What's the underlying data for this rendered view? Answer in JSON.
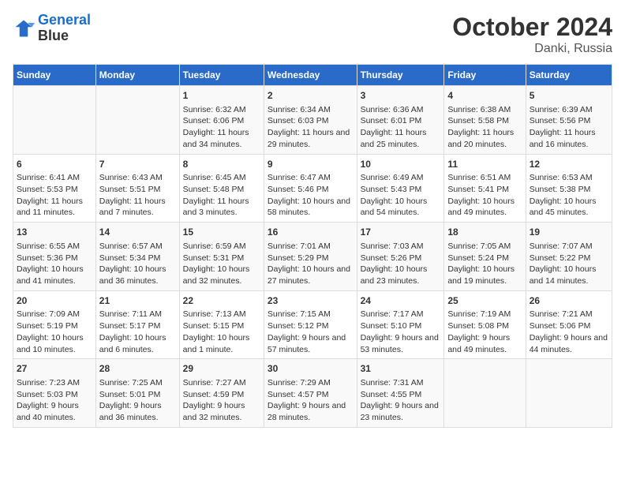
{
  "header": {
    "logo_line1": "General",
    "logo_line2": "Blue",
    "title": "October 2024",
    "subtitle": "Danki, Russia"
  },
  "days_of_week": [
    "Sunday",
    "Monday",
    "Tuesday",
    "Wednesday",
    "Thursday",
    "Friday",
    "Saturday"
  ],
  "weeks": [
    [
      {
        "day": "",
        "info": ""
      },
      {
        "day": "",
        "info": ""
      },
      {
        "day": "1",
        "info": "Sunrise: 6:32 AM\nSunset: 6:06 PM\nDaylight: 11 hours and 34 minutes."
      },
      {
        "day": "2",
        "info": "Sunrise: 6:34 AM\nSunset: 6:03 PM\nDaylight: 11 hours and 29 minutes."
      },
      {
        "day": "3",
        "info": "Sunrise: 6:36 AM\nSunset: 6:01 PM\nDaylight: 11 hours and 25 minutes."
      },
      {
        "day": "4",
        "info": "Sunrise: 6:38 AM\nSunset: 5:58 PM\nDaylight: 11 hours and 20 minutes."
      },
      {
        "day": "5",
        "info": "Sunrise: 6:39 AM\nSunset: 5:56 PM\nDaylight: 11 hours and 16 minutes."
      }
    ],
    [
      {
        "day": "6",
        "info": "Sunrise: 6:41 AM\nSunset: 5:53 PM\nDaylight: 11 hours and 11 minutes."
      },
      {
        "day": "7",
        "info": "Sunrise: 6:43 AM\nSunset: 5:51 PM\nDaylight: 11 hours and 7 minutes."
      },
      {
        "day": "8",
        "info": "Sunrise: 6:45 AM\nSunset: 5:48 PM\nDaylight: 11 hours and 3 minutes."
      },
      {
        "day": "9",
        "info": "Sunrise: 6:47 AM\nSunset: 5:46 PM\nDaylight: 10 hours and 58 minutes."
      },
      {
        "day": "10",
        "info": "Sunrise: 6:49 AM\nSunset: 5:43 PM\nDaylight: 10 hours and 54 minutes."
      },
      {
        "day": "11",
        "info": "Sunrise: 6:51 AM\nSunset: 5:41 PM\nDaylight: 10 hours and 49 minutes."
      },
      {
        "day": "12",
        "info": "Sunrise: 6:53 AM\nSunset: 5:38 PM\nDaylight: 10 hours and 45 minutes."
      }
    ],
    [
      {
        "day": "13",
        "info": "Sunrise: 6:55 AM\nSunset: 5:36 PM\nDaylight: 10 hours and 41 minutes."
      },
      {
        "day": "14",
        "info": "Sunrise: 6:57 AM\nSunset: 5:34 PM\nDaylight: 10 hours and 36 minutes."
      },
      {
        "day": "15",
        "info": "Sunrise: 6:59 AM\nSunset: 5:31 PM\nDaylight: 10 hours and 32 minutes."
      },
      {
        "day": "16",
        "info": "Sunrise: 7:01 AM\nSunset: 5:29 PM\nDaylight: 10 hours and 27 minutes."
      },
      {
        "day": "17",
        "info": "Sunrise: 7:03 AM\nSunset: 5:26 PM\nDaylight: 10 hours and 23 minutes."
      },
      {
        "day": "18",
        "info": "Sunrise: 7:05 AM\nSunset: 5:24 PM\nDaylight: 10 hours and 19 minutes."
      },
      {
        "day": "19",
        "info": "Sunrise: 7:07 AM\nSunset: 5:22 PM\nDaylight: 10 hours and 14 minutes."
      }
    ],
    [
      {
        "day": "20",
        "info": "Sunrise: 7:09 AM\nSunset: 5:19 PM\nDaylight: 10 hours and 10 minutes."
      },
      {
        "day": "21",
        "info": "Sunrise: 7:11 AM\nSunset: 5:17 PM\nDaylight: 10 hours and 6 minutes."
      },
      {
        "day": "22",
        "info": "Sunrise: 7:13 AM\nSunset: 5:15 PM\nDaylight: 10 hours and 1 minute."
      },
      {
        "day": "23",
        "info": "Sunrise: 7:15 AM\nSunset: 5:12 PM\nDaylight: 9 hours and 57 minutes."
      },
      {
        "day": "24",
        "info": "Sunrise: 7:17 AM\nSunset: 5:10 PM\nDaylight: 9 hours and 53 minutes."
      },
      {
        "day": "25",
        "info": "Sunrise: 7:19 AM\nSunset: 5:08 PM\nDaylight: 9 hours and 49 minutes."
      },
      {
        "day": "26",
        "info": "Sunrise: 7:21 AM\nSunset: 5:06 PM\nDaylight: 9 hours and 44 minutes."
      }
    ],
    [
      {
        "day": "27",
        "info": "Sunrise: 7:23 AM\nSunset: 5:03 PM\nDaylight: 9 hours and 40 minutes."
      },
      {
        "day": "28",
        "info": "Sunrise: 7:25 AM\nSunset: 5:01 PM\nDaylight: 9 hours and 36 minutes."
      },
      {
        "day": "29",
        "info": "Sunrise: 7:27 AM\nSunset: 4:59 PM\nDaylight: 9 hours and 32 minutes."
      },
      {
        "day": "30",
        "info": "Sunrise: 7:29 AM\nSunset: 4:57 PM\nDaylight: 9 hours and 28 minutes."
      },
      {
        "day": "31",
        "info": "Sunrise: 7:31 AM\nSunset: 4:55 PM\nDaylight: 9 hours and 23 minutes."
      },
      {
        "day": "",
        "info": ""
      },
      {
        "day": "",
        "info": ""
      }
    ]
  ]
}
